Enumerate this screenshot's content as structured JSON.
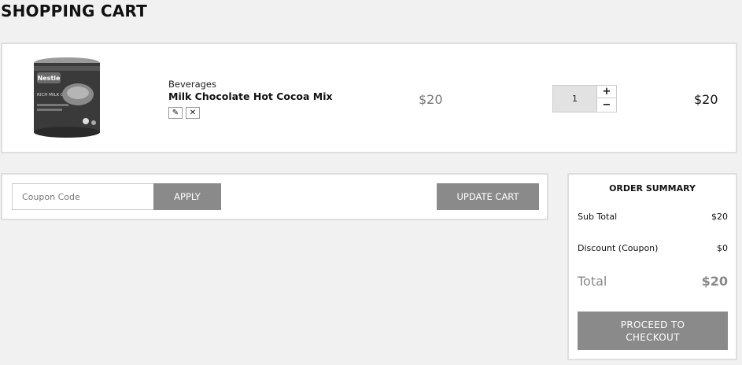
{
  "header": {
    "title": "SHOPPING CART"
  },
  "cart": {
    "items": [
      {
        "category": "Beverages",
        "name": "Milk Chocolate Hot Cocoa Mix",
        "price": "$20",
        "quantity": "1",
        "total": "$20",
        "image_brand_text": "Nestle",
        "image_product_text": "RICH MILK CHOCOLATE",
        "actions": {
          "edit_icon": "pencil-icon",
          "remove_icon": "close-icon",
          "edit_glyph": "✎",
          "remove_glyph": "✕"
        },
        "qty_controls": {
          "increase": "+",
          "decrease": "−"
        }
      }
    ]
  },
  "coupon": {
    "placeholder": "Coupon Code",
    "value": "",
    "apply_label": "APPLY",
    "update_label": "UPDATE CART"
  },
  "summary": {
    "title": "ORDER SUMMARY",
    "subtotal_label": "Sub Total",
    "subtotal_value": "$20",
    "discount_label": "Discount (Coupon)",
    "discount_value": "$0",
    "total_label": "Total",
    "total_value": "$20",
    "checkout_label_line1": "PROCEED TO",
    "checkout_label_line2": "CHECKOUT"
  },
  "colors": {
    "page_bg": "#f1f1f1",
    "panel_bg": "#ffffff",
    "button_gray": "#8a8a8a",
    "border": "#dedede"
  }
}
